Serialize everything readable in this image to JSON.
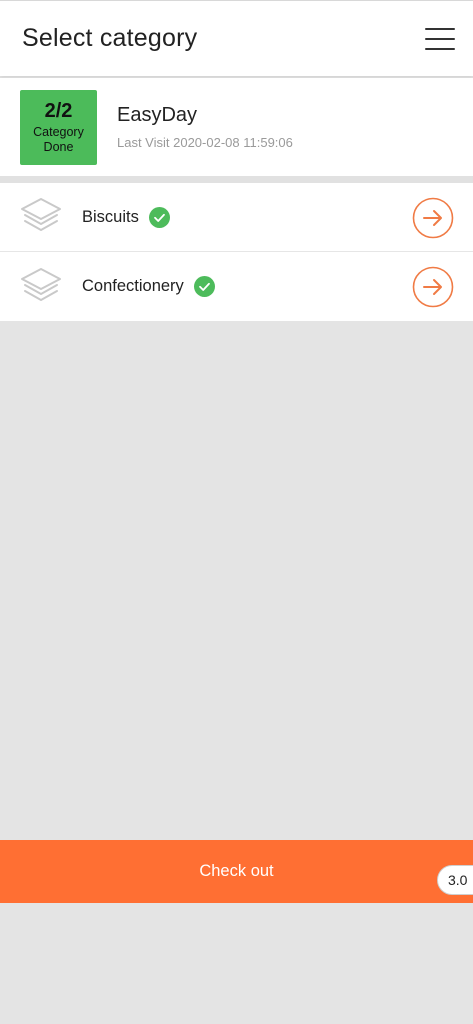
{
  "header": {
    "title": "Select category",
    "menu_icon": "hamburger-menu-icon"
  },
  "store": {
    "progress_count": "2/2",
    "progress_label": "Category Done",
    "name": "EasyDay",
    "last_visit": "Last Visit 2020-02-08 11:59:06"
  },
  "categories": [
    {
      "name": "Biscuits",
      "done": true
    },
    {
      "name": "Confectionery",
      "done": true
    }
  ],
  "footer": {
    "checkout_label": "Check out",
    "version": "3.0"
  },
  "colors": {
    "accent": "#ff6f33",
    "done_green": "#4cbb5a",
    "check_green": "#4dbb5b",
    "background": "#e4e4e4"
  }
}
